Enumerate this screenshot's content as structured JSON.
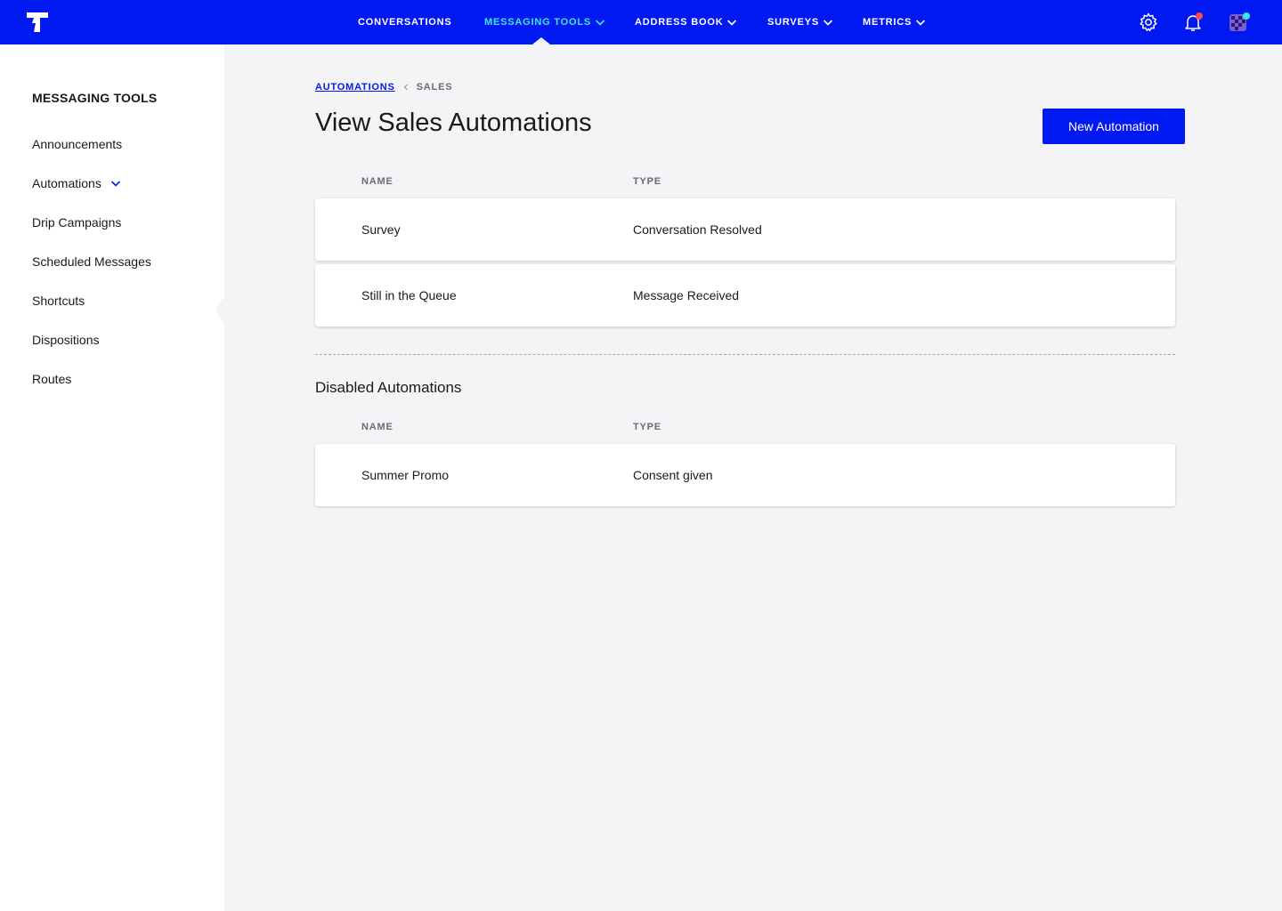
{
  "nav": {
    "items": [
      {
        "label": "CONVERSATIONS",
        "has_dropdown": false,
        "active": false
      },
      {
        "label": "MESSAGING TOOLS",
        "has_dropdown": true,
        "active": true
      },
      {
        "label": "ADDRESS BOOK",
        "has_dropdown": true,
        "active": false
      },
      {
        "label": "SURVEYS",
        "has_dropdown": true,
        "active": false
      },
      {
        "label": "METRICS",
        "has_dropdown": true,
        "active": false
      }
    ],
    "icons": [
      "gear-icon",
      "bell-icon",
      "avatar"
    ],
    "colors": {
      "bar": "#0019f0",
      "active": "#3ee6f0",
      "notification_dot": "#ff4a4a",
      "avatar_dot": "#3ee6f0"
    }
  },
  "sidebar": {
    "title": "MESSAGING TOOLS",
    "items": [
      {
        "label": "Announcements"
      },
      {
        "label": "Automations",
        "expanded": true
      },
      {
        "label": "Drip Campaigns"
      },
      {
        "label": "Scheduled Messages"
      },
      {
        "label": "Shortcuts"
      },
      {
        "label": "Dispositions"
      },
      {
        "label": "Routes"
      }
    ]
  },
  "breadcrumb": {
    "parent": "AUTOMATIONS",
    "current": "SALES"
  },
  "page": {
    "title": "View Sales Automations",
    "new_button": "New Automation"
  },
  "active_table": {
    "columns": [
      "NAME",
      "TYPE"
    ],
    "rows": [
      {
        "name": "Survey",
        "type": "Conversation Resolved"
      },
      {
        "name": "Still in the Queue",
        "type": "Message Received"
      }
    ]
  },
  "disabled_section": {
    "title": "Disabled Automations",
    "columns": [
      "NAME",
      "TYPE"
    ],
    "rows": [
      {
        "name": "Summer Promo",
        "type": "Consent given"
      }
    ]
  }
}
